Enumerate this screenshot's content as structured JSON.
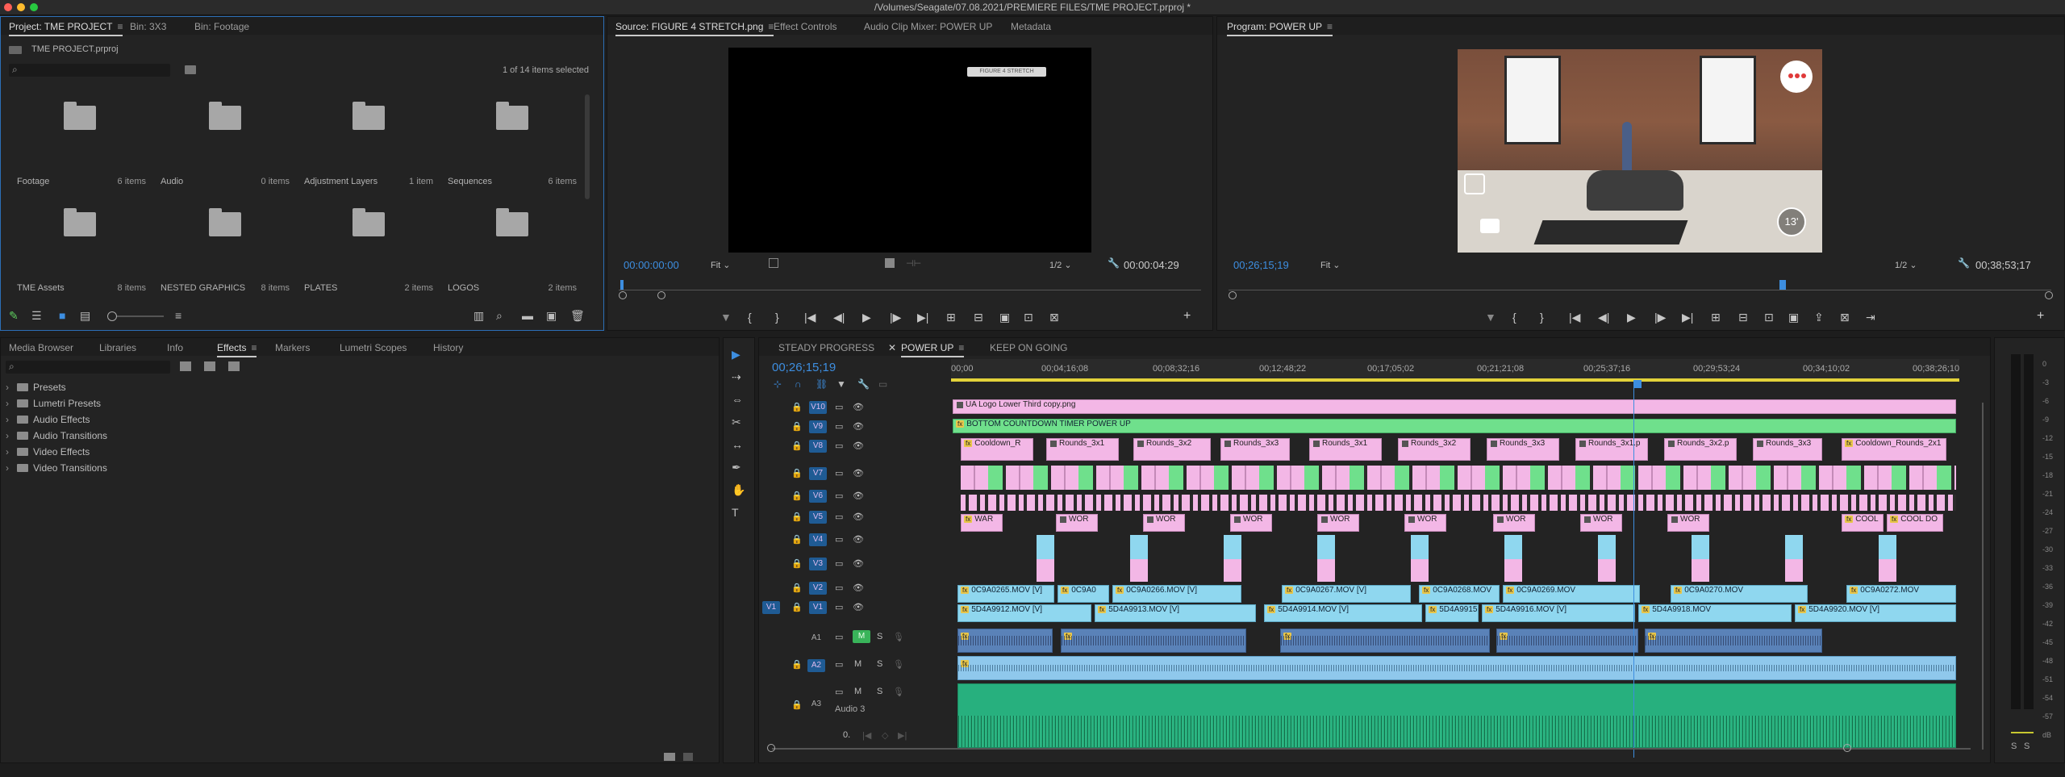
{
  "window": {
    "title": "/Volumes/Seagate/07.08.2021/PREMIERE FILES/TME PROJECT.prproj *"
  },
  "project": {
    "tabs": [
      "Project: TME PROJECT",
      "Bin: 3X3",
      "Bin: Footage"
    ],
    "path": "TME PROJECT.prproj",
    "selection": "1 of 14 items selected",
    "search_placeholder": "",
    "bins": [
      {
        "name": "Footage",
        "count": "6 items"
      },
      {
        "name": "Audio",
        "count": "0 items"
      },
      {
        "name": "Adjustment Layers",
        "count": "1 item"
      },
      {
        "name": "Sequences",
        "count": "6 items"
      },
      {
        "name": "TME Assets",
        "count": "8 items"
      },
      {
        "name": "NESTED GRAPHICS",
        "count": "8 items"
      },
      {
        "name": "PLATES",
        "count": "2 items"
      },
      {
        "name": "LOGOS",
        "count": "2 items"
      }
    ]
  },
  "source": {
    "tabs": [
      "Source: FIGURE 4 STRETCH.png",
      "Effect Controls",
      "Audio Clip Mixer: POWER UP",
      "Metadata"
    ],
    "timecode": "00:00:00:00",
    "fit": "Fit",
    "resolution": "1/2",
    "duration": "00:00:04:29",
    "overlay_label": "FIGURE 4 STRETCH"
  },
  "program": {
    "tab": "Program: POWER UP",
    "timecode": "00;26;15;19",
    "fit": "Fit",
    "resolution": "1/2",
    "duration": "00;38;53;17",
    "timer_badge": "13'",
    "progress": 0.67
  },
  "effects": {
    "tabs": [
      "Media Browser",
      "Libraries",
      "Info",
      "Effects",
      "Markers",
      "Lumetri Scopes",
      "History"
    ],
    "items": [
      "Presets",
      "Lumetri Presets",
      "Audio Effects",
      "Audio Transitions",
      "Video Effects",
      "Video Transitions"
    ]
  },
  "timeline": {
    "tabs": [
      "STEADY PROGRESS",
      "POWER UP",
      "KEEP ON GOING"
    ],
    "timecode": "00;26;15;19",
    "ruler": [
      "00;00",
      "00;04;16;08",
      "00;08;32;16",
      "00;12;48;22",
      "00;17;05;02",
      "00;21;21;08",
      "00;25;37;16",
      "00;29;53;24",
      "00;34;10;02",
      "00;38;26;10"
    ],
    "video_tracks": [
      "V10",
      "V9",
      "V8",
      "V7",
      "V6",
      "V5",
      "V4",
      "V3",
      "V2",
      "V1"
    ],
    "source_patch": "V1",
    "audio_tracks": [
      "A1",
      "A2",
      "A3"
    ],
    "audio3_name": "Audio 3",
    "audio_master": "0.",
    "v10_clip": "UA Logo Lower Third copy.png",
    "v9_clip": "BOTTOM COUNTDOWN TIMER POWER UP",
    "v8_clips": [
      "Cooldown_R",
      "Rounds_3x1",
      "Rounds_3x2",
      "Rounds_3x3",
      "Rounds_3x1",
      "Rounds_3x2",
      "Rounds_3x3",
      "Rounds_3x1.p",
      "Rounds_3x2.p",
      "Rounds_3x3",
      "Cooldown_Rounds_2x1"
    ],
    "v5_clips": [
      "WAR",
      "WOR",
      "WOR",
      "WOR",
      "WOR",
      "WOR",
      "WOR",
      "WOR",
      "WOR",
      "COOL",
      "COOL DO"
    ],
    "v2_clips": [
      "0C9A0265.MOV [V]",
      "0C9A0",
      "0C9A0266.MOV [V]",
      "0C9A0267.MOV [V]",
      "0C9A0268.MOV",
      "0C9A0269.MOV",
      "0C9A0270.MOV",
      "0C9A0272.MOV"
    ],
    "v1_clips": [
      "5D4A9912.MOV [V]",
      "5D4A9913.MOV [V]",
      "5D4A9914.MOV [V]",
      "5D4A9915.",
      "5D4A9916.MOV [V]",
      "5D4A9918.MOV",
      "5D4A9920.MOV [V]"
    ],
    "mute_label": "M",
    "solo_label": "S"
  },
  "meter_scale": [
    "0",
    "-3",
    "-6",
    "-9",
    "-12",
    "-15",
    "-18",
    "-21",
    "-24",
    "-27",
    "-30",
    "-33",
    "-36",
    "-39",
    "-42",
    "-45",
    "-48",
    "-51",
    "-54",
    "-57",
    "dB"
  ],
  "meter_solo": [
    "S",
    "S"
  ],
  "colors": {
    "accent": "#2c6fb7",
    "timecode": "#3d8ee0",
    "pink": "#f3b7e6",
    "blue": "#8fd7ef",
    "green": "#6fe08c",
    "audio_green": "#27b07e"
  }
}
